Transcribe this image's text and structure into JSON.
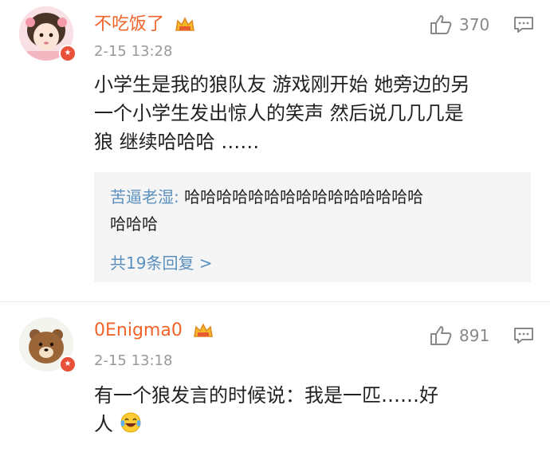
{
  "comments": [
    {
      "username": "不吃饭了",
      "timestamp": "2-15 13:28",
      "likes": "370",
      "content": "小学生是我的狼队友 游戏刚开始 她旁边的另一个小学生发出惊人的笑声 然后说几几几是狼 继续哈哈哈 ……",
      "content_lines": [
        "小学生是我的狼队友 游戏刚开始 她旁边的另",
        "一个小学生发出惊人的笑声 然后说几几几是",
        "狼 继续哈哈哈 ……"
      ],
      "reply": {
        "author": "苦逼老湿:",
        "text_line1": " 哈哈哈哈哈哈哈哈哈哈哈哈哈哈哈",
        "text_line2": "哈哈哈",
        "more": "共19条回复 >"
      }
    },
    {
      "username": "0Enigma0",
      "timestamp": "2-15 13:18",
      "likes": "891",
      "content_lines": [
        "有一个狼发言的时候说：我是一匹……好",
        "人"
      ],
      "emoji": "laughing-tears-emoji"
    }
  ],
  "colors": {
    "username": "#f0642b",
    "link": "#5a8fbf",
    "time": "#999999",
    "badge": "#e8503a"
  }
}
